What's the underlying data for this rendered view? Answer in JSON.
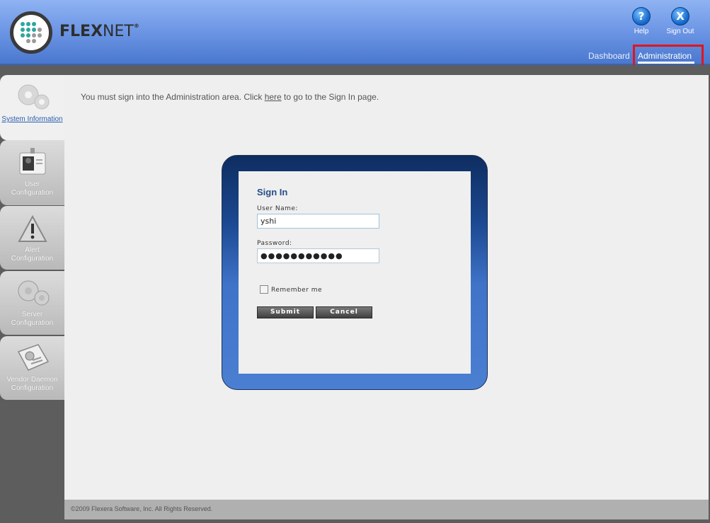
{
  "header": {
    "brand_bold": "FLEX",
    "brand_light": "NET",
    "brand_mark": "®",
    "help_label": "Help",
    "help_glyph": "?",
    "signout_label": "Sign Out",
    "signout_glyph": "X"
  },
  "nav": {
    "dashboard": "Dashboard",
    "administration": "Administration"
  },
  "sidebar": {
    "items": [
      {
        "label": "System Information",
        "icon": "gears-icon"
      },
      {
        "label_line1": "User",
        "label_line2": "Configuration",
        "icon": "id-badge-icon"
      },
      {
        "label_line1": "Alert",
        "label_line2": "Configuration",
        "icon": "warning-icon"
      },
      {
        "label": "Server Configuration",
        "icon": "gears-icon"
      },
      {
        "label_line1": "Vendor Daemon",
        "label_line2": "Configuration",
        "icon": "certificate-icon"
      }
    ]
  },
  "main": {
    "notice_prefix": "You must sign into the Administration area. Click ",
    "notice_link": "here",
    "notice_suffix": " to go to the Sign In page."
  },
  "signin": {
    "title": "Sign In",
    "username_label": "User Name:",
    "username_value": "yshi",
    "password_label": "Password:",
    "password_value": "●●●●●●●●●●●",
    "remember_label": "Remember me",
    "submit_label": "Submit",
    "cancel_label": "Cancel"
  },
  "footer": {
    "copyright": "©2009 Flexera Software, Inc. All Rights Reserved."
  },
  "colors": {
    "header_top": "#8fb3f2",
    "header_bottom": "#4a78cf",
    "highlight_box": "#e3141b",
    "panel_dark": "#0e2d61",
    "panel_light": "#4b7fd2"
  }
}
